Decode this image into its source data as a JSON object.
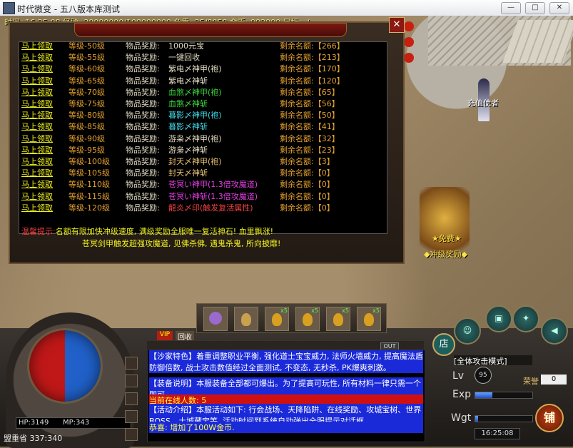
{
  "window": {
    "title": "时代微变 - 五八版本库测试",
    "buttons": [
      "—",
      "□",
      "✕"
    ]
  },
  "status_line": "时间: 16:25:08 经验: 30000000/100000000 负重: 35/8058 金币: 993000 目标: -/-",
  "reward_panel": {
    "close_label": "✕",
    "rows": [
      {
        "claim": "马上领取",
        "level": "等级-50级",
        "reward_label": "物品奖励:",
        "reward": "1000元宝",
        "reward_color": "#e0d8c0",
        "remain": "剩余名额:【266】"
      },
      {
        "claim": "马上领取",
        "level": "等级-55级",
        "reward_label": "物品奖励:",
        "reward": "一键回收",
        "reward_color": "#e0d8c0",
        "remain": "剩余名额:【213】"
      },
      {
        "claim": "马上领取",
        "level": "等级-60级",
        "reward_label": "物品奖励:",
        "reward": "紫电〆神甲(袍)",
        "reward_color": "#e0d8c0",
        "remain": "剩余名额:【170】"
      },
      {
        "claim": "马上领取",
        "level": "等级-65级",
        "reward_label": "物品奖励:",
        "reward": "紫电〆神斩",
        "reward_color": "#e0d8c0",
        "remain": "剩余名额:【120】"
      },
      {
        "claim": "马上领取",
        "level": "等级-70级",
        "reward_label": "物品奖励:",
        "reward": "血煞〆神甲(袍)",
        "reward_color": "#3cd83c",
        "remain": "剩余名额:【65】"
      },
      {
        "claim": "马上领取",
        "level": "等级-75级",
        "reward_label": "物品奖励:",
        "reward": "血煞〆神斩",
        "reward_color": "#3cd83c",
        "remain": "剩余名额:【56】"
      },
      {
        "claim": "马上领取",
        "level": "等级-80级",
        "reward_label": "物品奖励:",
        "reward": "暮影〆神甲(袍)",
        "reward_color": "#40d8e8",
        "remain": "剩余名额:【50】"
      },
      {
        "claim": "马上领取",
        "level": "等级-85级",
        "reward_label": "物品奖励:",
        "reward": "暮影〆神斩",
        "reward_color": "#40d8e8",
        "remain": "剩余名额:【41】"
      },
      {
        "claim": "马上领取",
        "level": "等级-90级",
        "reward_label": "物品奖励:",
        "reward": "游枭〆神甲(袍)",
        "reward_color": "#e0d8c0",
        "remain": "剩余名额:【32】"
      },
      {
        "claim": "马上领取",
        "level": "等级-95级",
        "reward_label": "物品奖励:",
        "reward": "游枭〆神斩",
        "reward_color": "#e0d8c0",
        "remain": "剩余名额:【23】"
      },
      {
        "claim": "马上领取",
        "level": "等级-100级",
        "reward_label": "物品奖励:",
        "reward": "封天〆神甲(袍)",
        "reward_color": "#e8c070",
        "remain": "剩余名额:【3】"
      },
      {
        "claim": "马上领取",
        "level": "等级-105级",
        "reward_label": "物品奖励:",
        "reward": "封天〆神斩",
        "reward_color": "#e8c070",
        "remain": "剩余名额:【0】"
      },
      {
        "claim": "马上领取",
        "level": "等级-110级",
        "reward_label": "物品奖励:",
        "reward": "苍冥い神甲(1.3倍攻魔道)",
        "reward_color": "#e040e0",
        "remain": "剩余名额:【0】"
      },
      {
        "claim": "马上领取",
        "level": "等级-115级",
        "reward_label": "物品奖励:",
        "reward": "苍冥い神斩(1.3倍攻魔道)",
        "reward_color": "#e040e0",
        "remain": "剩余名额:【0】"
      },
      {
        "claim": "马上领取",
        "level": "等级-120级",
        "reward_label": "物品奖励:",
        "reward": "龍炎〆印(触发复活属性)",
        "reward_color": "#f04040",
        "remain": "剩余名额:【0】"
      }
    ],
    "tip_prefix": "温馨提示:",
    "tip_line1": "名额有限加快冲级速度, 满级奖励全服唯一复活神石! 血里飘涨!",
    "tip_line2": "苍冥剑甲触发超强攻魔道, 见佛杀佛, 遇鬼杀鬼, 所向披靡!"
  },
  "npcs": {
    "envoy": "充值使者",
    "reward_npc_top": "★免费★",
    "reward_npc_bottom": "◆冲级奖励◆"
  },
  "hud": {
    "hp": "HP:3149",
    "mp": "MP:343",
    "map_coords": "盟重省 337:340",
    "tabs": {
      "vip": "VIP",
      "back": "回收",
      "out": "OUT"
    },
    "belt_counts": [
      "",
      "",
      "x5",
      "x5",
      "x5",
      "x5"
    ],
    "attack_mode": "[全体攻击模式]",
    "level_label": "Lv",
    "level_value": "95",
    "honor_label": "荣誉",
    "honor_value": "0",
    "exp_label": "Exp",
    "exp_fraction": 0.3,
    "weight_label": "Wgt",
    "weight_fraction": 0.05,
    "clock": "16:25:08",
    "shop_label": "店",
    "shop2_label": "铺"
  },
  "chat": [
    {
      "text": "【沙家特色】着重调整职业平衡, 强化道士宝宝威力, 法师火墙威力, 提高魔法盾防御倍数, 战士攻击数值经过全面测试, 不变态, 无秒杀, PK爆爽刺激。",
      "fg": "#ffffff",
      "bg": "#1a2ad8"
    },
    {
      "text": "【装备说明】本服装备全部都可爆出。为了提高可玩性, 所有材料一律只需一个即可。",
      "fg": "#ffffff",
      "bg": "#1a2ad8"
    },
    {
      "text": "当前在线人数: 5",
      "fg": "#ffff40",
      "bg": "#d01010"
    },
    {
      "text": "【活动介绍】本服活动如下: 行会战场、天降陷阱、在线奖励、攻城宝树、世界BOSS、土城藏宝等, 活动时间到系统自动弹出全服提示对话框",
      "fg": "#ffffff",
      "bg": "#1a2ad8"
    },
    {
      "text": "恭喜: 增加了100W金币.",
      "fg": "#ffff40",
      "bg": "#1a2ad8"
    }
  ]
}
